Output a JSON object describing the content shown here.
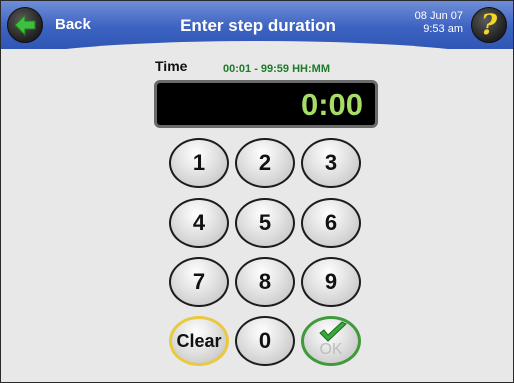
{
  "header": {
    "back_label": "Back",
    "title": "Enter step duration",
    "date": "08 Jun 07",
    "time": "9:53 am",
    "help_label": "?"
  },
  "time_input": {
    "label": "Time",
    "range": "00:01 - 99:59  HH:MM",
    "value": "0:00"
  },
  "keypad": {
    "keys": [
      "1",
      "2",
      "3",
      "4",
      "5",
      "6",
      "7",
      "8",
      "9"
    ],
    "clear": "Clear",
    "zero": "0",
    "ok": "OK"
  },
  "colors": {
    "header": "#3d63c2",
    "display_text": "#a7dc66",
    "range_text": "#1d7a2a",
    "clear_ring": "#e9c940",
    "ok_ring": "#3f9a3a"
  },
  "icons": {
    "back": "green-left-arrow-icon",
    "help": "question-mark-icon",
    "ok": "green-checkmark-icon"
  }
}
